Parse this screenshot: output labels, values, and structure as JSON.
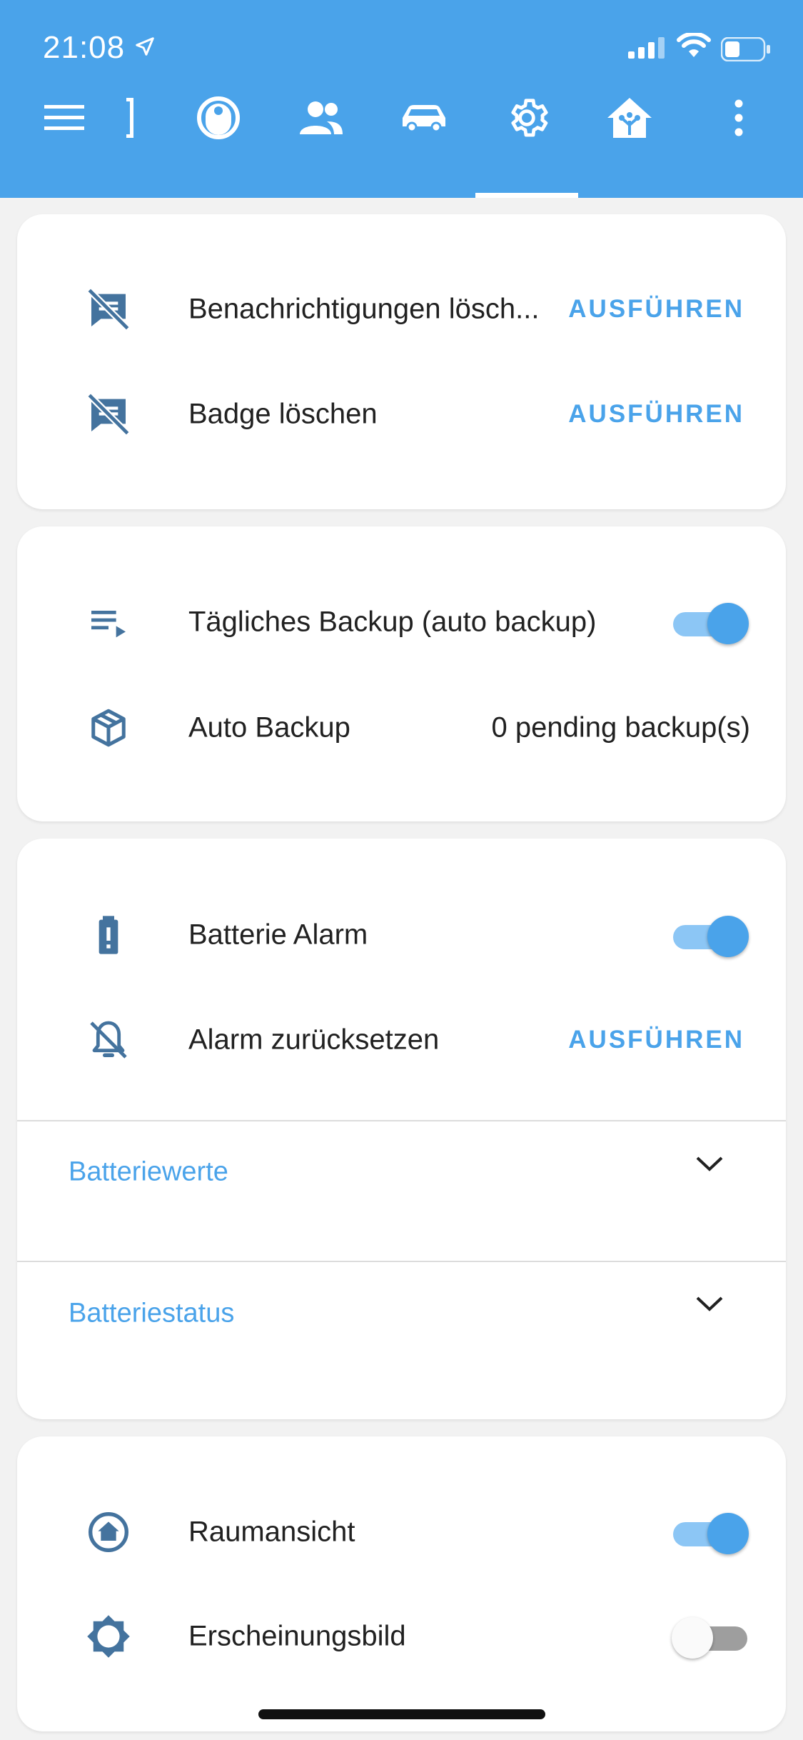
{
  "status_bar": {
    "time": "21:08"
  },
  "toolbar": {
    "menu_icon": "menu-icon",
    "tabs": [
      {
        "icon": "partial-tab-icon"
      },
      {
        "icon": "robot-vacuum-icon"
      },
      {
        "icon": "people-icon"
      },
      {
        "icon": "car-icon"
      },
      {
        "icon": "gear-icon",
        "active": true
      },
      {
        "icon": "home-network-icon"
      }
    ],
    "overflow_icon": "more-vertical-icon"
  },
  "cards": {
    "notifications": {
      "rows": [
        {
          "icon": "message-off-icon",
          "label": "Benachrichtigungen lösch...",
          "action": "AUSFÜHREN"
        },
        {
          "icon": "message-off-icon",
          "label": "Badge löschen",
          "action": "AUSFÜHREN"
        }
      ]
    },
    "backup": {
      "rows": [
        {
          "icon": "playlist-play-icon",
          "label": "Tägliches Backup (auto backup)",
          "toggle": true
        },
        {
          "icon": "package-icon",
          "label": "Auto Backup",
          "value": "0 pending backup(s)"
        }
      ]
    },
    "battery": {
      "rows": [
        {
          "icon": "battery-alert-icon",
          "label": "Batterie Alarm",
          "toggle": true
        },
        {
          "icon": "bell-off-icon",
          "label": "Alarm zurücksetzen",
          "action": "AUSFÜHREN"
        }
      ],
      "expanders": [
        {
          "title": "Batteriewerte"
        },
        {
          "title": "Batteriestatus"
        }
      ]
    },
    "view": {
      "rows": [
        {
          "icon": "home-circle-icon",
          "label": "Raumansicht",
          "toggle": true
        },
        {
          "icon": "brightness-icon",
          "label": "Erscheinungsbild",
          "toggle": false
        }
      ]
    }
  },
  "colors": {
    "accent": "#4aa3ea",
    "icon": "#44739e",
    "background": "#f2f2f2"
  }
}
